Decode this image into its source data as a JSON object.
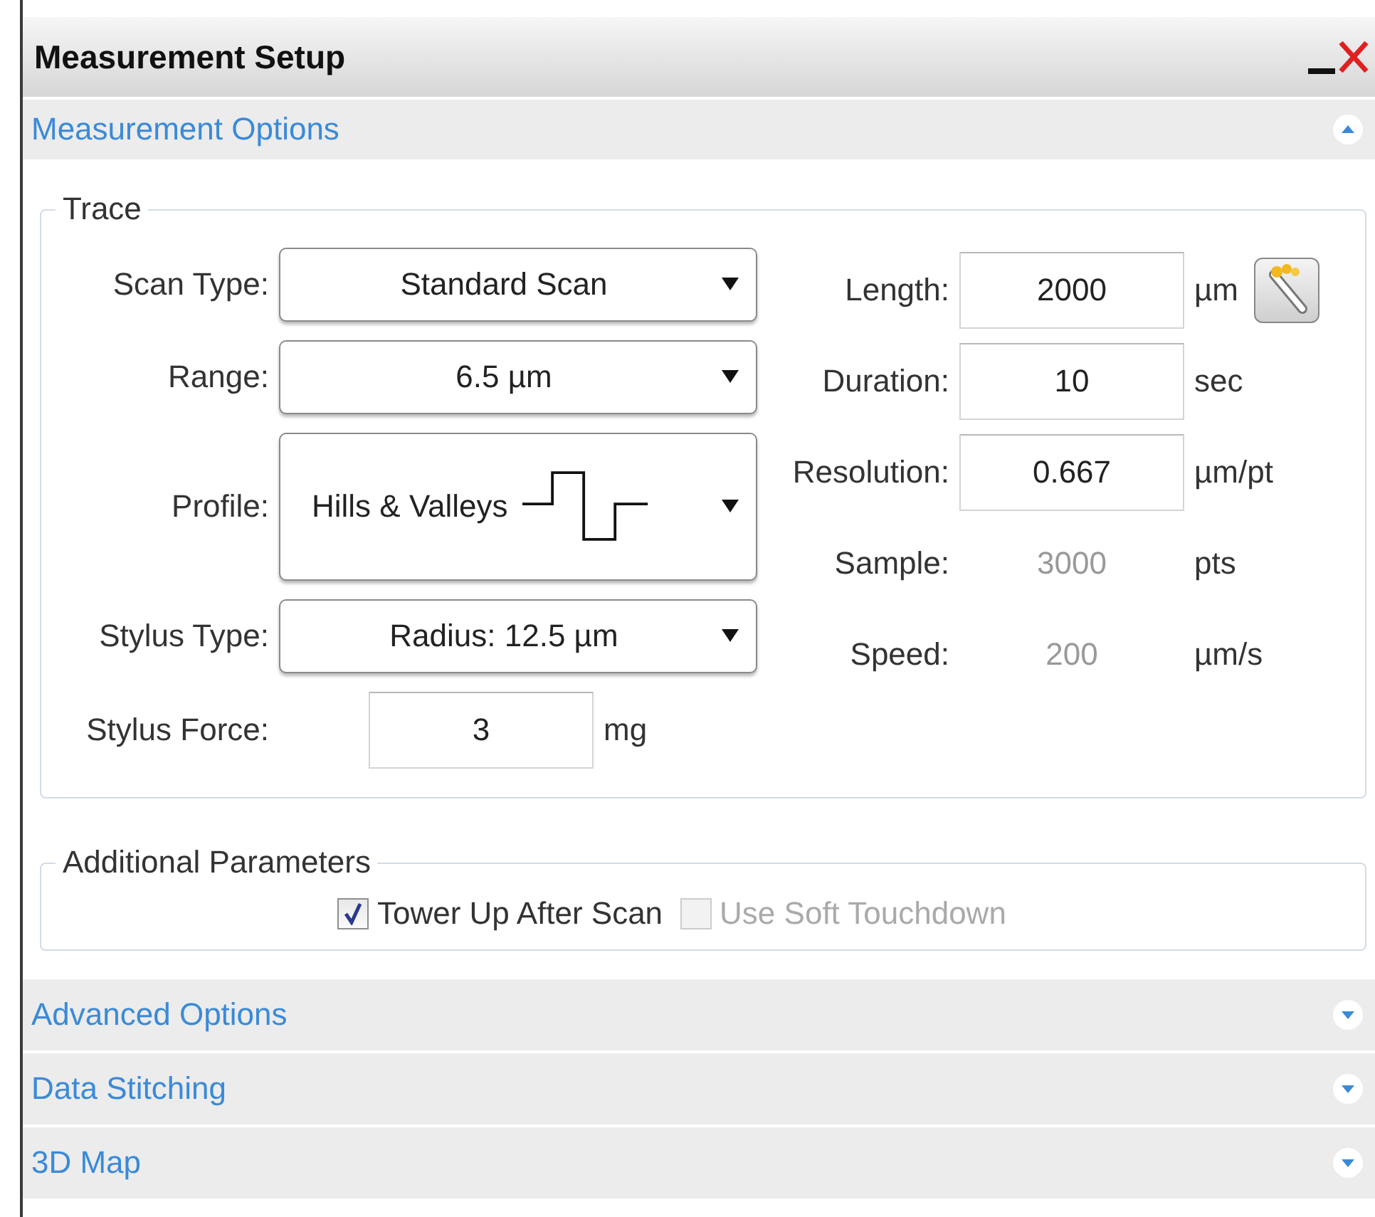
{
  "window": {
    "title": "Measurement Setup"
  },
  "sections": [
    {
      "title": "Measurement Options",
      "expanded": true
    },
    {
      "title": "Advanced Options",
      "expanded": false
    },
    {
      "title": "Data Stitching",
      "expanded": false
    },
    {
      "title": "3D Map",
      "expanded": false
    }
  ],
  "trace": {
    "legend": "Trace",
    "left_fields": [
      {
        "kind": "dropdown",
        "label": "Scan Type:",
        "value": "Standard Scan"
      },
      {
        "kind": "dropdown",
        "label": "Range:",
        "value": "6.5 µm"
      },
      {
        "kind": "profile-dropdown",
        "label": "Profile:",
        "value": "Hills & Valleys"
      },
      {
        "kind": "dropdown",
        "label": "Stylus Type:",
        "value": "Radius: 12.5 µm"
      },
      {
        "kind": "input",
        "label": "Stylus Force:",
        "value": "3",
        "unit": "mg"
      }
    ],
    "right_fields": [
      {
        "kind": "input-with-tool",
        "label": "Length:",
        "value": "2000",
        "unit": "µm"
      },
      {
        "kind": "input",
        "label": "Duration:",
        "value": "10",
        "unit": "sec"
      },
      {
        "kind": "input",
        "label": "Resolution:",
        "value": "0.667",
        "unit": "µm/pt"
      },
      {
        "kind": "readout",
        "label": "Sample:",
        "value": "3000",
        "unit": "pts"
      },
      {
        "kind": "readout",
        "label": "Speed:",
        "value": "200",
        "unit": "µm/s"
      }
    ]
  },
  "additional_parameters": {
    "legend": "Additional Parameters",
    "checkboxes": [
      {
        "label": "Tower Up After Scan",
        "checked": true,
        "disabled": false
      },
      {
        "label": "Use Soft Touchdown",
        "checked": false,
        "disabled": true
      }
    ]
  }
}
